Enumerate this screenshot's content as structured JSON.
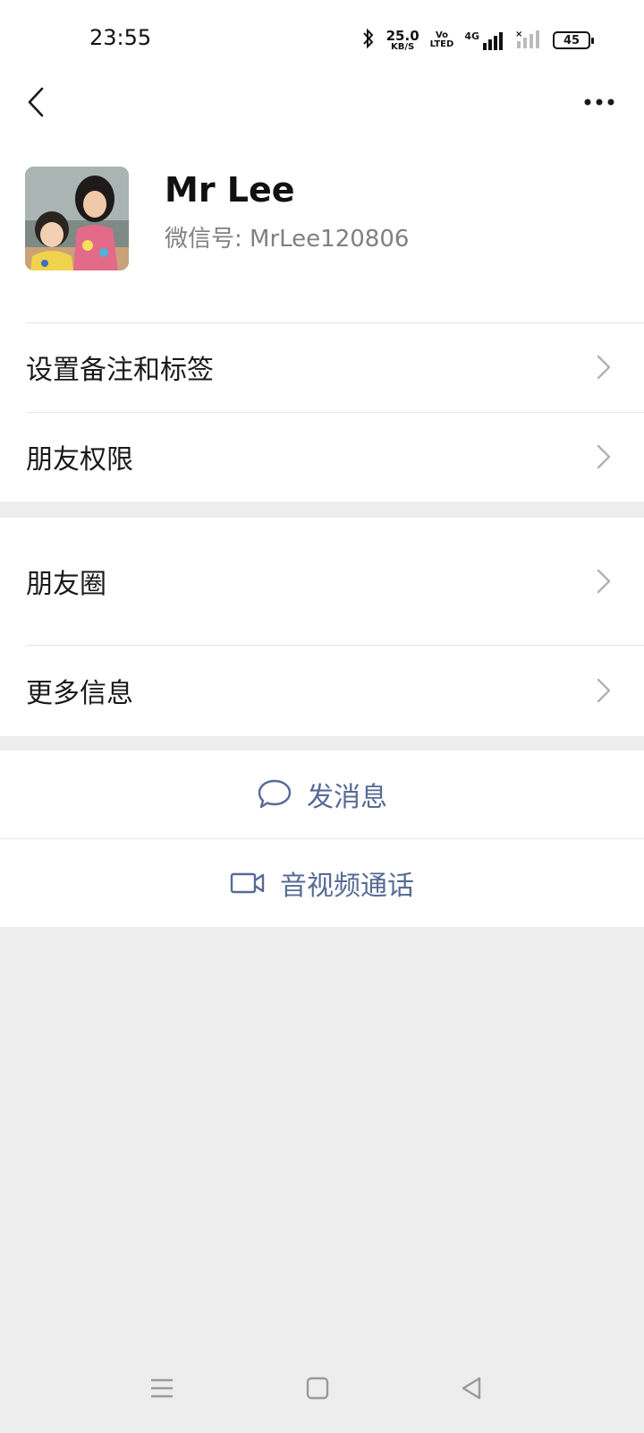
{
  "status_bar": {
    "time": "23:55",
    "net_speed_value": "25.0",
    "net_speed_unit": "KB/S",
    "volte_top": "Vo",
    "volte_bottom": "LTED",
    "network": "4G",
    "battery": "45"
  },
  "profile": {
    "name": "Mr Lee",
    "wechat_id": "微信号: MrLee120806"
  },
  "menu": {
    "set_remark_tags": "设置备注和标签",
    "friend_permissions": "朋友权限",
    "moments": "朋友圈",
    "more_info": "更多信息"
  },
  "actions": {
    "send_message": "发消息",
    "video_call": "音视频通话"
  },
  "colors": {
    "link": "#576b95",
    "background": "#ededed"
  },
  "icons": [
    "bluetooth-icon",
    "signal-icon",
    "back-icon",
    "more-icon",
    "chevron-right-icon",
    "chat-bubble-icon",
    "video-camera-icon",
    "menu-icon",
    "home-icon",
    "back-triangle-icon"
  ]
}
